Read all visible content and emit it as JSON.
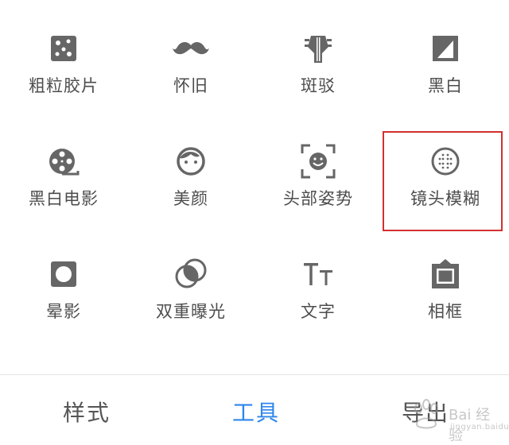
{
  "tools": [
    {
      "label": "粗粒胶片",
      "icon": "grainy-film-icon"
    },
    {
      "label": "怀旧",
      "icon": "mustache-icon"
    },
    {
      "label": "斑驳",
      "icon": "guitar-head-icon"
    },
    {
      "label": "黑白",
      "icon": "black-white-icon"
    },
    {
      "label": "黑白电影",
      "icon": "film-reel-icon"
    },
    {
      "label": "美颜",
      "icon": "face-icon"
    },
    {
      "label": "头部姿势",
      "icon": "face-frame-icon"
    },
    {
      "label": "镜头模糊",
      "icon": "lens-blur-icon"
    },
    {
      "label": "晕影",
      "icon": "vignette-icon"
    },
    {
      "label": "双重曝光",
      "icon": "double-exposure-icon"
    },
    {
      "label": "文字",
      "icon": "text-icon"
    },
    {
      "label": "相框",
      "icon": "frame-icon"
    }
  ],
  "tabs": {
    "styles": "样式",
    "tools": "工具",
    "export": "导出"
  },
  "watermark": {
    "text": "Bai 经验",
    "sub": "jingyan.baidu.com"
  },
  "colors": {
    "icon": "#666666",
    "active_tab": "#2f86ea",
    "highlight": "#d32f2f"
  }
}
